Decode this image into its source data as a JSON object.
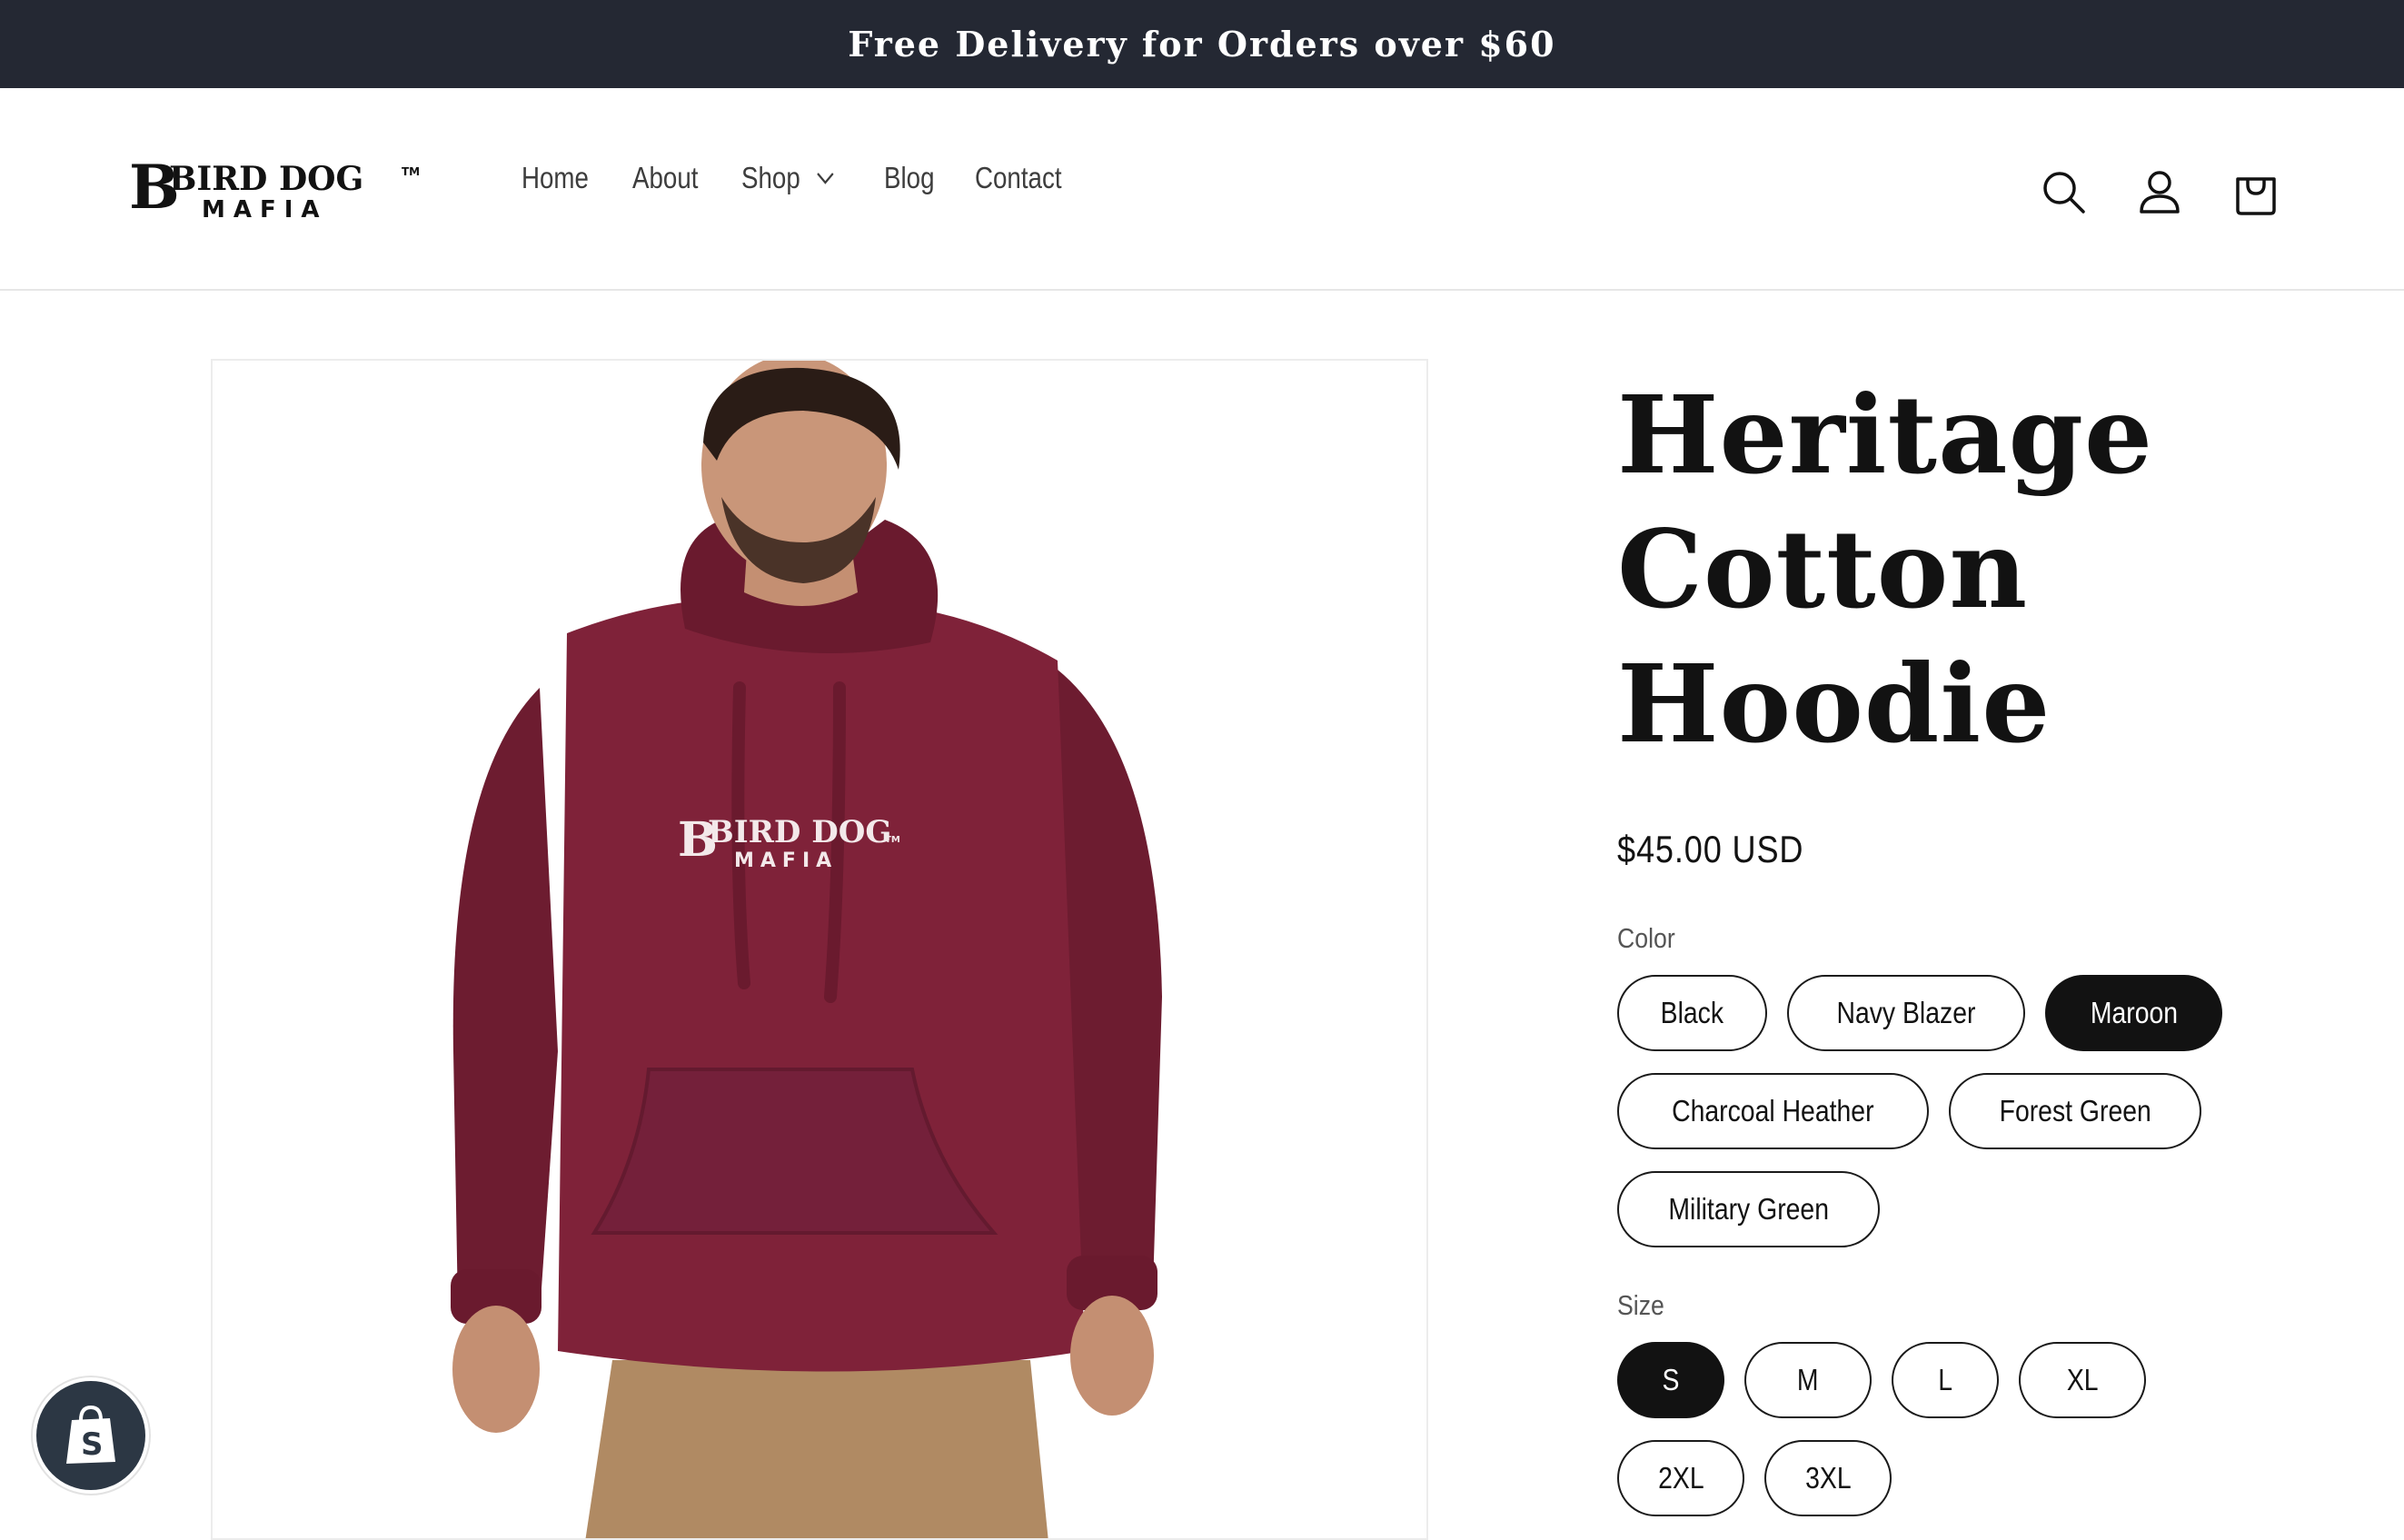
{
  "announcement": {
    "text": "Free Delivery for Orders over $60"
  },
  "header": {
    "logo": {
      "line1": "BIRD DOG",
      "line2": "MAFIA",
      "tm": "TM"
    },
    "nav": [
      {
        "label": "Home"
      },
      {
        "label": "About"
      },
      {
        "label": "Shop",
        "has_dropdown": true
      },
      {
        "label": "Blog"
      },
      {
        "label": "Contact"
      }
    ],
    "icons": [
      "search-icon",
      "account-icon",
      "cart-icon"
    ]
  },
  "product": {
    "title_lines": [
      "Heritage",
      "Cotton",
      "Hoodie"
    ],
    "price": "$45.00 USD",
    "image_print": {
      "line1": "BIRD DOG",
      "line2": "MAFIA",
      "tm": "TM"
    },
    "color": {
      "label": "Color",
      "options": [
        "Black",
        "Navy Blazer",
        "Maroon",
        "Charcoal Heather",
        "Forest Green",
        "Military Green"
      ],
      "selected": "Maroon"
    },
    "size": {
      "label": "Size",
      "options": [
        "S",
        "M",
        "L",
        "XL",
        "2XL",
        "3XL"
      ],
      "selected": "S"
    }
  },
  "colors": {
    "announcement_bg": "#242833",
    "text": "#121212",
    "hoodie": "#7f2239",
    "pants": "#b08a63",
    "shopify_badge": "#2c3744"
  },
  "floating": {
    "icon": "shopify-bag-icon"
  }
}
